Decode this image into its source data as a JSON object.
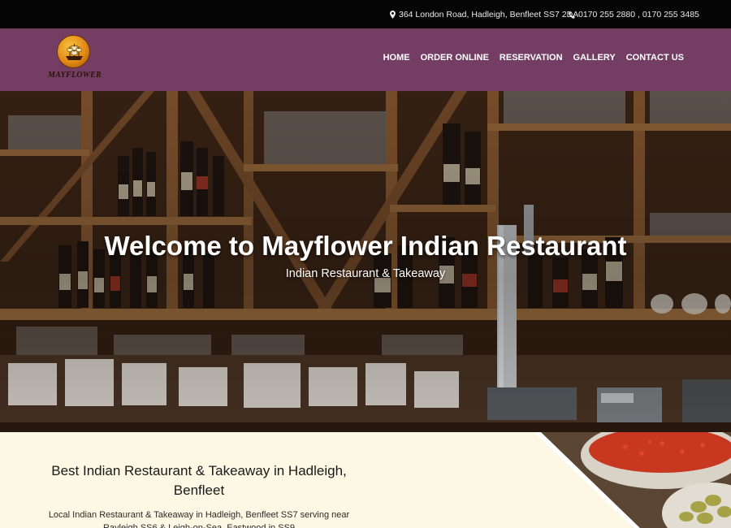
{
  "topbar": {
    "address": "364 London Road, Hadleigh, Benfleet SS7 2DA",
    "address_icon": "map-marker-icon",
    "phone": "0170 255 2880 , 0170 255 3485",
    "phone_icon": "phone-icon"
  },
  "header": {
    "logo_text": "MAYFLOWER",
    "nav": [
      "HOME",
      "ORDER ONLINE",
      "RESERVATION",
      "GALLERY",
      "CONTACT US"
    ],
    "background_color": "#743d64"
  },
  "hero": {
    "title": "Welcome to Mayflower Indian Restaurant",
    "subtitle": "Indian Restaurant & Takeaway"
  },
  "intro": {
    "heading": "Best Indian Restaurant & Takeaway in Hadleigh, Benfleet",
    "text": "Local Indian Restaurant & Takeaway in Hadleigh, Benfleet SS7 serving near Rayleigh SS6 & Leigh-on-Sea, Eastwood in SS9"
  },
  "colors": {
    "topbar": "#050505",
    "header": "#743d64",
    "content_bg": "#fdf8e4"
  }
}
